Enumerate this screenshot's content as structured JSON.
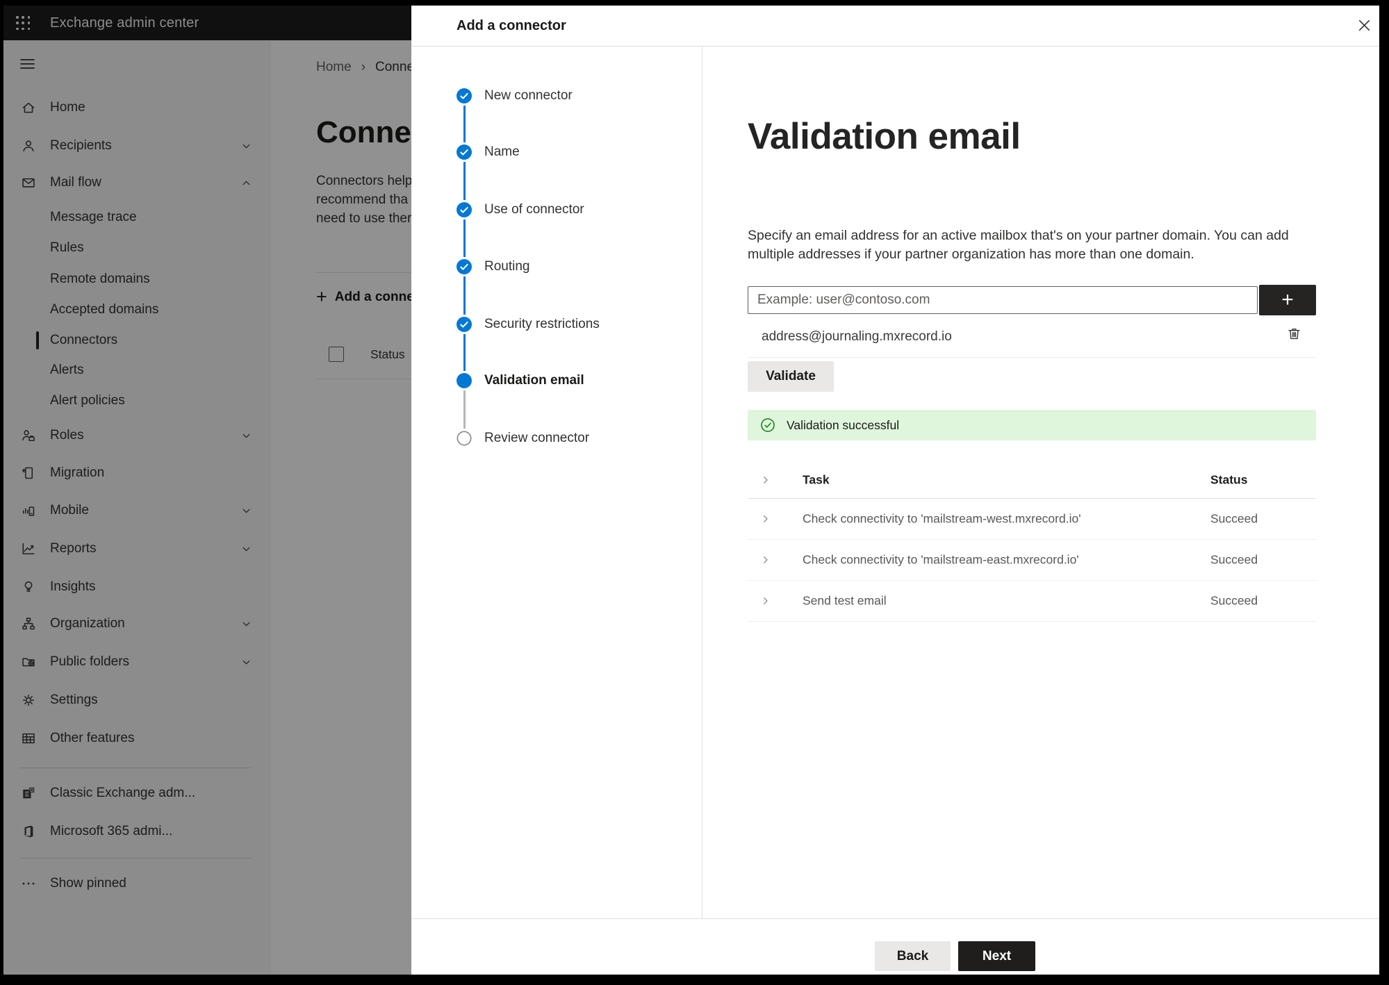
{
  "colors": {
    "accent": "#0078d4",
    "success_bg": "#dff6dd",
    "success_icon": "#107c10",
    "dark_button": "#1f1e1d",
    "header_bg": "#1c1c1c",
    "sidebar_bg": "#f3f2f1"
  },
  "header": {
    "app_title": "Exchange admin center",
    "waffle_icon": "waffle-icon"
  },
  "background_page": {
    "hamburger_icon": "hamburger-icon",
    "breadcrumb": {
      "items": [
        "Home",
        "Connectors"
      ],
      "separator": "›"
    },
    "page_title": "Connectors",
    "intro_lines": [
      "Connectors help",
      "recommend tha",
      "need to use ther"
    ],
    "add_button_label": "Add a connector",
    "status_header": "Status"
  },
  "sidebar": {
    "items": [
      {
        "label": "Home",
        "icon": "home-icon",
        "level": 0,
        "chevron": "none",
        "selected": false
      },
      {
        "label": "Recipients",
        "icon": "person-icon",
        "level": 0,
        "chevron": "down",
        "selected": false
      },
      {
        "label": "Mail flow",
        "icon": "mail-icon",
        "level": 0,
        "chevron": "up",
        "selected": false
      },
      {
        "label": "Message trace",
        "icon": "",
        "level": 1,
        "chevron": "none",
        "selected": false
      },
      {
        "label": "Rules",
        "icon": "",
        "level": 1,
        "chevron": "none",
        "selected": false
      },
      {
        "label": "Remote domains",
        "icon": "",
        "level": 1,
        "chevron": "none",
        "selected": false
      },
      {
        "label": "Accepted domains",
        "icon": "",
        "level": 1,
        "chevron": "none",
        "selected": false
      },
      {
        "label": "Connectors",
        "icon": "",
        "level": 1,
        "chevron": "none",
        "selected": true
      },
      {
        "label": "Alerts",
        "icon": "",
        "level": 1,
        "chevron": "none",
        "selected": false
      },
      {
        "label": "Alert policies",
        "icon": "",
        "level": 1,
        "chevron": "none",
        "selected": false
      },
      {
        "label": "Roles",
        "icon": "roles-icon",
        "level": 0,
        "chevron": "down",
        "selected": false
      },
      {
        "label": "Migration",
        "icon": "migration-icon",
        "level": 0,
        "chevron": "none",
        "selected": false
      },
      {
        "label": "Mobile",
        "icon": "mobile-icon",
        "level": 0,
        "chevron": "down",
        "selected": false
      },
      {
        "label": "Reports",
        "icon": "reports-icon",
        "level": 0,
        "chevron": "down",
        "selected": false
      },
      {
        "label": "Insights",
        "icon": "insights-icon",
        "level": 0,
        "chevron": "none",
        "selected": false
      },
      {
        "label": "Organization",
        "icon": "organization-icon",
        "level": 0,
        "chevron": "down",
        "selected": false
      },
      {
        "label": "Public folders",
        "icon": "public-folders-icon",
        "level": 0,
        "chevron": "down",
        "selected": false
      },
      {
        "label": "Settings",
        "icon": "settings-icon",
        "level": 0,
        "chevron": "none",
        "selected": false
      },
      {
        "label": "Other features",
        "icon": "other-features-icon",
        "level": 0,
        "chevron": "none",
        "selected": false
      },
      {
        "label": "Classic Exchange adm...",
        "icon": "classic-exchange-icon",
        "level": 0,
        "chevron": "none",
        "selected": false
      },
      {
        "label": "Microsoft 365 admi...",
        "icon": "microsoft-365-icon",
        "level": 0,
        "chevron": "none",
        "selected": false
      },
      {
        "label": "Show pinned",
        "icon": "ellipsis-icon",
        "level": 0,
        "chevron": "none",
        "selected": false
      }
    ]
  },
  "dialog": {
    "title": "Add a connector",
    "close_icon": "close-icon",
    "steps": [
      {
        "label": "New connector",
        "state": "complete"
      },
      {
        "label": "Name",
        "state": "complete"
      },
      {
        "label": "Use of connector",
        "state": "complete"
      },
      {
        "label": "Routing",
        "state": "complete"
      },
      {
        "label": "Security restrictions",
        "state": "complete"
      },
      {
        "label": "Validation email",
        "state": "current"
      },
      {
        "label": "Review connector",
        "state": "upcoming"
      }
    ],
    "content": {
      "title": "Validation email",
      "description": "Specify an email address for an active mailbox that's on your partner domain. You can add multiple addresses if your partner organization has more than one domain.",
      "email_input": {
        "value": "",
        "placeholder": "Example: user@contoso.com"
      },
      "add_address_button": "+",
      "addresses": [
        "address@journaling.mxrecord.io"
      ],
      "delete_icon": "trash-icon",
      "validate_button": "Validate",
      "validation_banner": {
        "icon": "check-circle-icon",
        "text": "Validation successful"
      },
      "task_table": {
        "headers": [
          "Task",
          "Status"
        ],
        "row_icon": "chevron-right-icon",
        "rows": [
          {
            "task": "Check connectivity to 'mailstream-west.mxrecord.io'",
            "status": "Succeed"
          },
          {
            "task": "Check connectivity to 'mailstream-east.mxrecord.io'",
            "status": "Succeed"
          },
          {
            "task": "Send test email",
            "status": "Succeed"
          }
        ]
      }
    },
    "footer": {
      "back": "Back",
      "next": "Next"
    }
  }
}
